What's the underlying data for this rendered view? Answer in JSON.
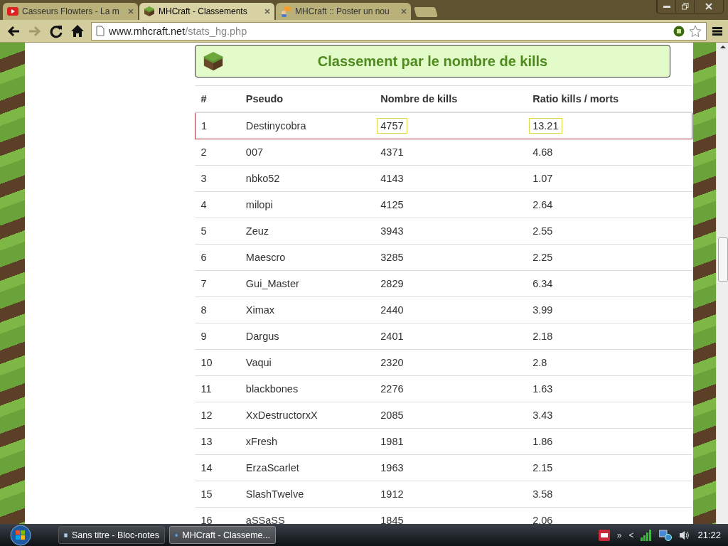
{
  "tabs": [
    {
      "title": "Casseurs Flowters - La m",
      "selected": false
    },
    {
      "title": "MHCraft - Classements",
      "selected": true
    },
    {
      "title": "MHCraft :: Poster un nou",
      "selected": false
    }
  ],
  "address_bar": {
    "host": "www.mhcraft.net",
    "path": "/stats_hg.php"
  },
  "header": {
    "title": "Classement par le nombre de kills"
  },
  "table": {
    "columns": [
      "#",
      "Pseudo",
      "Nombre de kills",
      "Ratio kills / morts"
    ],
    "rows": [
      {
        "rank": "1",
        "pseudo": "Destinycobra",
        "kills": "4757",
        "ratio": "13.21",
        "selected": true
      },
      {
        "rank": "2",
        "pseudo": "007",
        "kills": "4371",
        "ratio": "4.68",
        "selected": false
      },
      {
        "rank": "3",
        "pseudo": "nbko52",
        "kills": "4143",
        "ratio": "1.07",
        "selected": false
      },
      {
        "rank": "4",
        "pseudo": "milopi",
        "kills": "4125",
        "ratio": "2.64",
        "selected": false
      },
      {
        "rank": "5",
        "pseudo": "Zeuz",
        "kills": "3943",
        "ratio": "2.55",
        "selected": false
      },
      {
        "rank": "6",
        "pseudo": "Maescro",
        "kills": "3285",
        "ratio": "2.25",
        "selected": false
      },
      {
        "rank": "7",
        "pseudo": "Gui_Master",
        "kills": "2829",
        "ratio": "6.34",
        "selected": false
      },
      {
        "rank": "8",
        "pseudo": "Ximax",
        "kills": "2440",
        "ratio": "3.99",
        "selected": false
      },
      {
        "rank": "9",
        "pseudo": "Dargus",
        "kills": "2401",
        "ratio": "2.18",
        "selected": false
      },
      {
        "rank": "10",
        "pseudo": "Vaqui",
        "kills": "2320",
        "ratio": "2.8",
        "selected": false
      },
      {
        "rank": "11",
        "pseudo": "blackbones",
        "kills": "2276",
        "ratio": "1.63",
        "selected": false
      },
      {
        "rank": "12",
        "pseudo": "XxDestructorxX",
        "kills": "2085",
        "ratio": "3.43",
        "selected": false
      },
      {
        "rank": "13",
        "pseudo": "xFresh",
        "kills": "1981",
        "ratio": "1.86",
        "selected": false
      },
      {
        "rank": "14",
        "pseudo": "ErzaScarlet",
        "kills": "1963",
        "ratio": "2.15",
        "selected": false
      },
      {
        "rank": "15",
        "pseudo": "SlashTwelve",
        "kills": "1912",
        "ratio": "3.58",
        "selected": false
      },
      {
        "rank": "16",
        "pseudo": "aSSaSS",
        "kills": "1845",
        "ratio": "2.06",
        "selected": false
      }
    ]
  },
  "taskbar": {
    "tasks": [
      {
        "title": "Sans titre - Bloc-notes",
        "selected": false
      },
      {
        "title": "MHCraft - Classeme...",
        "selected": true
      }
    ],
    "tray_more": "»",
    "tray_expand": "<",
    "clock": "21:22"
  }
}
